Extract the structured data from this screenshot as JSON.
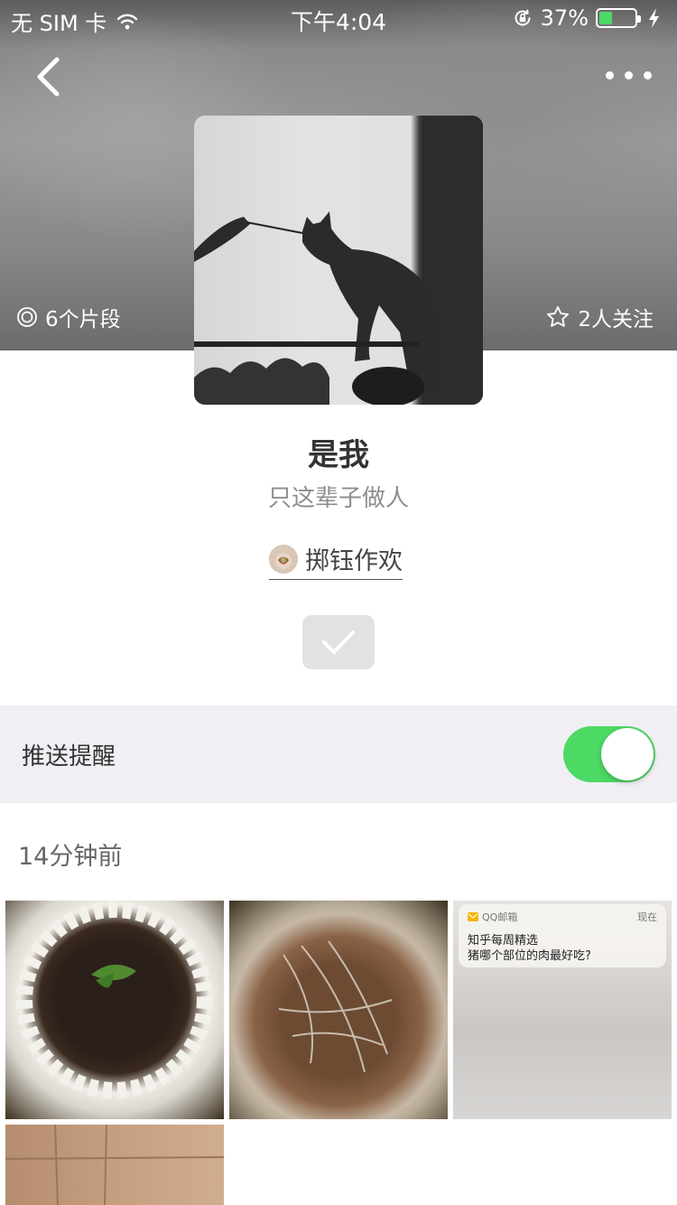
{
  "status_bar": {
    "carrier": "无 SIM 卡",
    "time": "下午4:04",
    "battery_percent_label": "37%",
    "battery_level": 0.37
  },
  "nav": {
    "back_icon": "chevron-left-icon",
    "more_icon": "more-horizontal-icon"
  },
  "collection": {
    "segments": "6个片段",
    "followers": "2人关注",
    "title": "是我",
    "subtitle": "只这辈子做人",
    "author": "掷钰作欢"
  },
  "push": {
    "label": "推送提醒",
    "enabled": true
  },
  "feed": {
    "time_label": "14分钟前",
    "notification": {
      "app": "QQ邮箱",
      "time": "现在",
      "line1": "知乎每周精选",
      "line2": "猪哪个部位的肉最好吃?"
    }
  },
  "colors": {
    "accent_green": "#4cd964",
    "row_bg": "#efeff4"
  }
}
